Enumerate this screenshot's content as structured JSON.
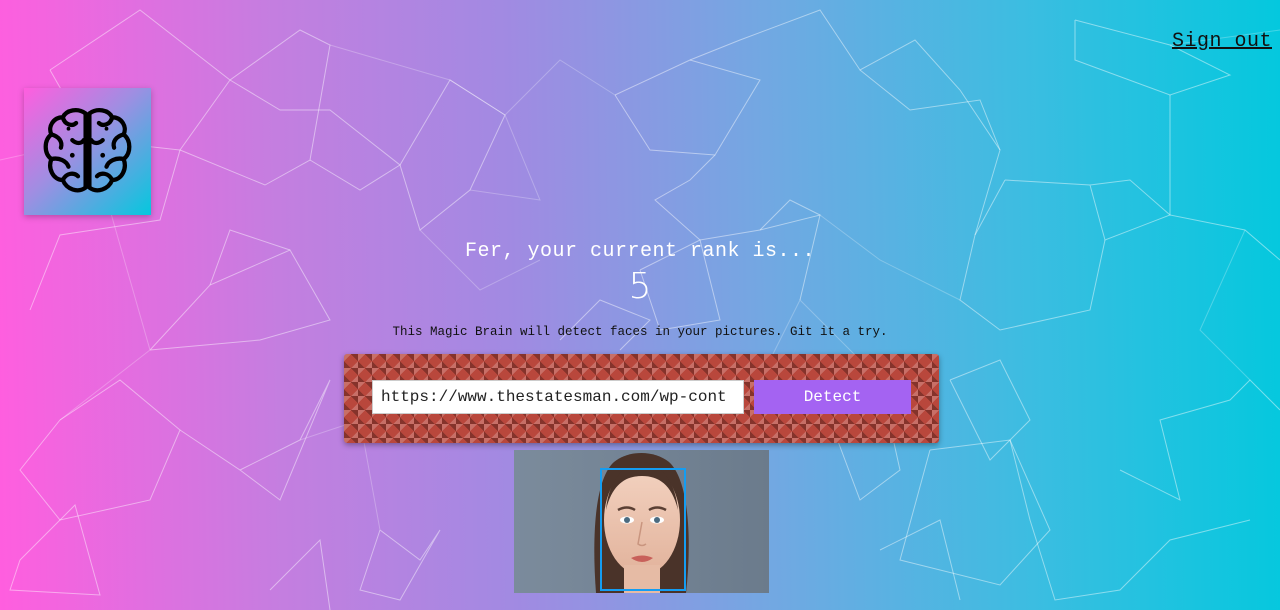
{
  "nav": {
    "sign_out_label": "Sign out"
  },
  "logo": {
    "icon": "brain-icon"
  },
  "rank": {
    "message": "Fer, your current rank is...",
    "value": "5"
  },
  "tagline": "This Magic Brain will detect faces in your pictures. Git it a try.",
  "form": {
    "url_value": "https://www.thestatesman.com/wp-cont",
    "detect_label": "Detect"
  },
  "colors": {
    "gradient_left": "#ff5edf",
    "gradient_right": "#04c8de",
    "button": "#a463f2",
    "panel": "#b9473c",
    "face_box": "#149df2"
  }
}
